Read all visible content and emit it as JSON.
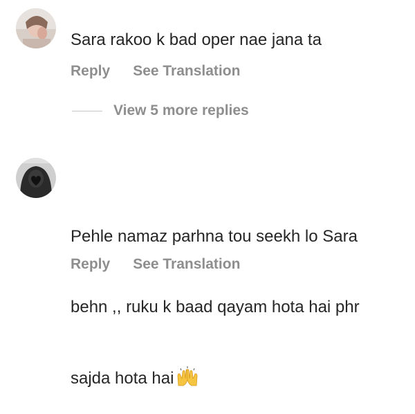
{
  "comments": [
    {
      "avatar_icon": "user-avatar-photo",
      "text": "Sara rakoo k bad oper nae jana ta",
      "reply_label": "Reply",
      "translation_label": "See Translation"
    },
    {
      "avatar_icon": "user-avatar-hijab",
      "text_line1": "Pehle namaz parhna tou seekh lo Sara",
      "text_line2": "behn ,, ruku k baad qayam hota hai phr",
      "text_line3": "sajda hota hai",
      "emoji_icon": "raising-hands-emoji",
      "reply_label": "Reply",
      "translation_label": "See Translation"
    }
  ],
  "view_replies_label": "View 5 more replies",
  "colors": {
    "text": "#262626",
    "secondary": "#8e8e8e",
    "divider": "#c7c7c7"
  }
}
